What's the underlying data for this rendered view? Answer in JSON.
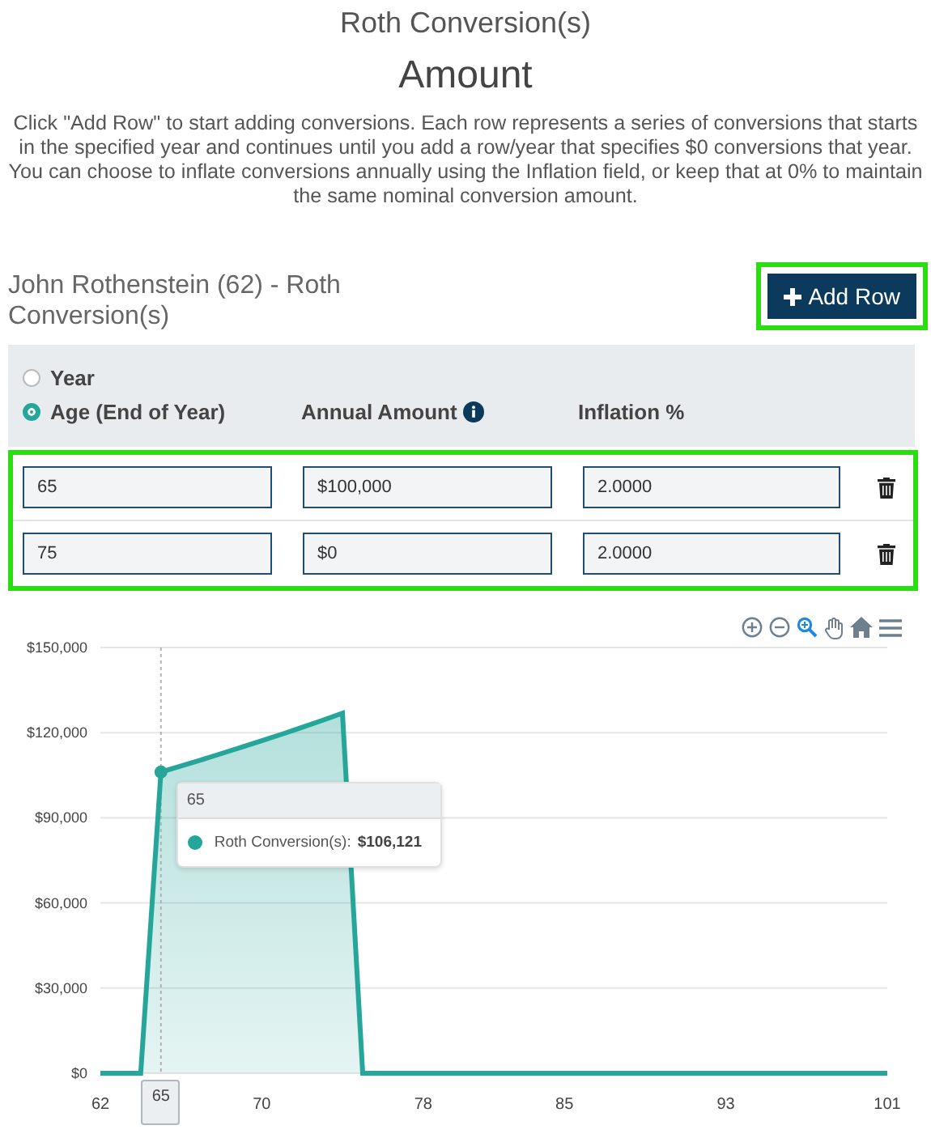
{
  "header": {
    "title": "Roth Conversion(s)",
    "subtitle": "Amount",
    "description": "Click \"Add Row\" to start adding conversions. Each row represents a series of conversions that starts in the specified year and continues until you add a row/year that specifies $0 conversions that year. You can choose to inflate conversions annually using the Inflation field, or keep that at 0% to maintain the same nominal conversion amount."
  },
  "section": {
    "title": "John Rothenstein (62) - Roth Conversion(s)",
    "add_button": "Add Row"
  },
  "mode_options": [
    {
      "label": "Year",
      "selected": false
    },
    {
      "label": "Age (End of Year)",
      "selected": true
    }
  ],
  "columns": [
    {
      "label": "Annual Amount",
      "info": true
    },
    {
      "label": "Inflation %",
      "info": false
    }
  ],
  "rows": [
    {
      "start": "65",
      "amount": "$100,000",
      "inflation": "2.0000"
    },
    {
      "start": "75",
      "amount": "$0",
      "inflation": "2.0000"
    }
  ],
  "chart": {
    "tooltip": {
      "title": "65",
      "value": "$106,121"
    },
    "crosshair_label": "65",
    "chart_data": {
      "type": "area",
      "x": [
        62,
        63,
        64,
        65,
        66,
        67,
        68,
        69,
        70,
        71,
        72,
        73,
        74,
        75,
        76,
        77,
        78,
        79,
        80,
        81,
        82,
        83,
        84,
        85,
        86,
        87,
        88,
        89,
        90,
        91,
        92,
        93,
        94,
        95,
        96,
        97,
        98,
        99,
        100,
        101
      ],
      "series": [
        {
          "name": "Roth Conversion(s):",
          "color": "#26a69a",
          "values": [
            0,
            0,
            0,
            106121,
            108243,
            110408,
            112616,
            114869,
            117166,
            119509,
            121899,
            124337,
            126824,
            0,
            0,
            0,
            0,
            0,
            0,
            0,
            0,
            0,
            0,
            0,
            0,
            0,
            0,
            0,
            0,
            0,
            0,
            0,
            0,
            0,
            0,
            0,
            0,
            0,
            0,
            0
          ]
        }
      ],
      "xlim": [
        62,
        101
      ],
      "ylim": [
        0,
        150000
      ],
      "grid": true,
      "ref_lines": [
        {
          "axis": "x",
          "value": 65
        }
      ],
      "yticks": [
        {
          "value": 0,
          "label": "$0"
        },
        {
          "value": 30000,
          "label": "$30,000"
        },
        {
          "value": 60000,
          "label": "$60,000"
        },
        {
          "value": 90000,
          "label": "$90,000"
        },
        {
          "value": 120000,
          "label": "$120,000"
        },
        {
          "value": 150000,
          "label": "$150,000"
        }
      ],
      "xticks": [
        62,
        70,
        78,
        85,
        93,
        101
      ]
    }
  }
}
